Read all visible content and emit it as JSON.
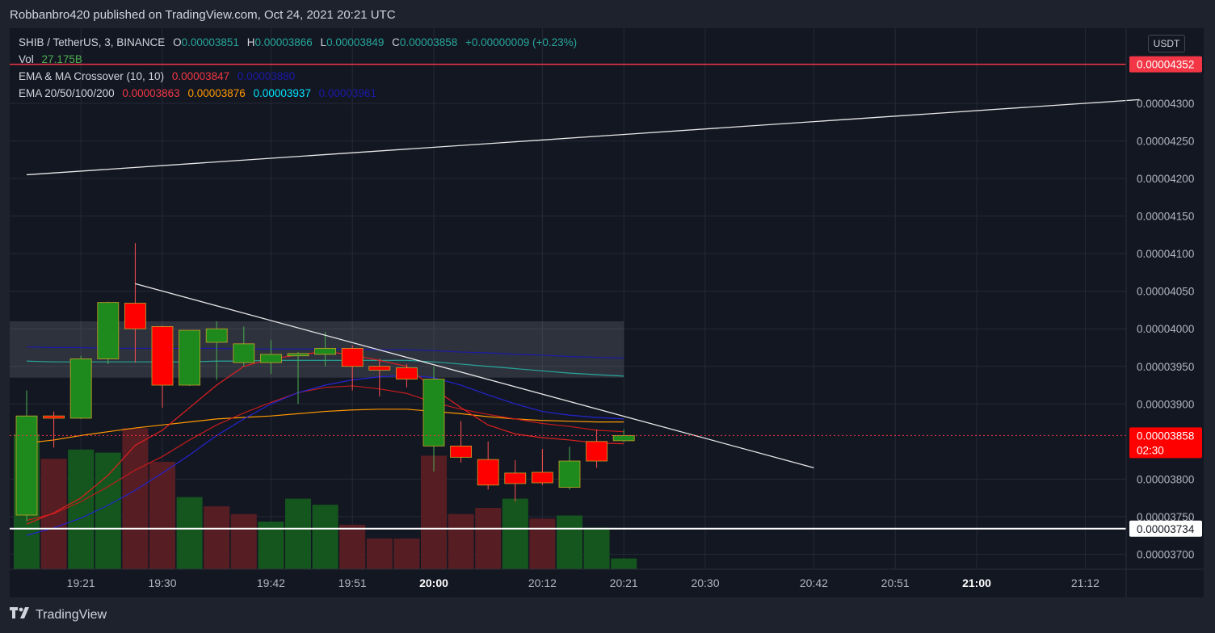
{
  "header": {
    "text": "Robbanbro420 published on TradingView.com, Oct 24, 2021 20:21 UTC"
  },
  "legend": {
    "symbol": "SHIB / TetherUS, 3, BINANCE",
    "o_label": "O",
    "o": "0.00003851",
    "h_label": "H",
    "h": "0.00003866",
    "l_label": "L",
    "l": "0.00003849",
    "c_label": "C",
    "c": "0.00003858",
    "change": "+0.00000009 (+0.23%)",
    "vol_label": "Vol",
    "vol": "27.175B",
    "crossover_label": "EMA & MA Crossover (10, 10)",
    "crossover_ema": "0.00003847",
    "crossover_ma": "0.00003880",
    "ema_label": "EMA 20/50/100/200",
    "ema20": "0.00003863",
    "ema50": "0.00003876",
    "ema100": "0.00003937",
    "ema200": "0.00003961"
  },
  "currency": "USDT",
  "footer": {
    "brand": "TradingView"
  },
  "colors": {
    "up": "#1e8a1e",
    "down": "#ff0000",
    "bg": "#131722",
    "grid": "#252a36",
    "ema20": "#c21c1c",
    "ema50": "#ff9800",
    "ema100": "#26a69a",
    "ema200": "#1a1aa6"
  },
  "chart_data": {
    "type": "candlestick",
    "x_ticks": [
      "19:21",
      "19:30",
      "19:42",
      "19:51",
      "20:00",
      "20:12",
      "20:21",
      "20:30",
      "20:42",
      "20:51",
      "21:00",
      "21:12"
    ],
    "y_ticks": [
      "0.00004300",
      "0.00004250",
      "0.00004200",
      "0.00004150",
      "0.00004100",
      "0.00004050",
      "0.00004000",
      "0.00003950",
      "0.00003900",
      "0.00003800",
      "0.00003750",
      "0.00003700"
    ],
    "y_range": [
      3.68e-05,
      4.4e-05
    ],
    "price_labels": {
      "alert_line": "0.00004352",
      "last_price": "0.00003858",
      "countdown": "02:30",
      "support_line": "0.00003734"
    },
    "candles": [
      {
        "o": 3.752e-05,
        "h": 3.918e-05,
        "l": 3.744e-05,
        "c": 3.884e-05
      },
      {
        "o": 3.884e-05,
        "h": 3.89e-05,
        "l": 3.842e-05,
        "c": 3.881e-05
      },
      {
        "o": 3.881e-05,
        "h": 3.964e-05,
        "l": 3.88e-05,
        "c": 3.96e-05
      },
      {
        "o": 3.96e-05,
        "h": 4.036e-05,
        "l": 3.953e-05,
        "c": 4.035e-05
      },
      {
        "o": 4.034e-05,
        "h": 4.114e-05,
        "l": 3.955e-05,
        "c": 4e-05
      },
      {
        "o": 4.003e-05,
        "h": 4.004e-05,
        "l": 3.895e-05,
        "c": 3.925e-05
      },
      {
        "o": 3.925e-05,
        "h": 3.998e-05,
        "l": 3.924e-05,
        "c": 3.998e-05
      },
      {
        "o": 3.982e-05,
        "h": 4.01e-05,
        "l": 3.932e-05,
        "c": 4e-05
      },
      {
        "o": 3.955e-05,
        "h": 4.003e-05,
        "l": 3.95e-05,
        "c": 3.98e-05
      },
      {
        "o": 3.955e-05,
        "h": 3.985e-05,
        "l": 3.94e-05,
        "c": 3.966e-05
      },
      {
        "o": 3.964e-05,
        "h": 3.969e-05,
        "l": 3.9e-05,
        "c": 3.967e-05
      },
      {
        "o": 3.966e-05,
        "h": 3.996e-05,
        "l": 3.95e-05,
        "c": 3.974e-05
      },
      {
        "o": 3.974e-05,
        "h": 3.978e-05,
        "l": 3.918e-05,
        "c": 3.95e-05
      },
      {
        "o": 3.95e-05,
        "h": 3.96e-05,
        "l": 3.91e-05,
        "c": 3.945e-05
      },
      {
        "o": 3.948e-05,
        "h": 3.953e-05,
        "l": 3.922e-05,
        "c": 3.933e-05
      },
      {
        "o": 3.844e-05,
        "h": 3.95e-05,
        "l": 3.81e-05,
        "c": 3.933e-05
      },
      {
        "o": 3.844e-05,
        "h": 3.877e-05,
        "l": 3.822e-05,
        "c": 3.829e-05
      },
      {
        "o": 3.826e-05,
        "h": 3.85e-05,
        "l": 3.786e-05,
        "c": 3.792e-05
      },
      {
        "o": 3.808e-05,
        "h": 3.825e-05,
        "l": 3.77e-05,
        "c": 3.794e-05
      },
      {
        "o": 3.809e-05,
        "h": 3.84e-05,
        "l": 3.792e-05,
        "c": 3.795e-05
      },
      {
        "o": 3.789e-05,
        "h": 3.843e-05,
        "l": 3.786e-05,
        "c": 3.824e-05
      },
      {
        "o": 3.85e-05,
        "h": 3.866e-05,
        "l": 3.815e-05,
        "c": 3.824e-05
      },
      {
        "o": 3.851e-05,
        "h": 3.866e-05,
        "l": 3.849e-05,
        "c": 3.858e-05
      }
    ],
    "volume": [
      0.88,
      0.72,
      0.78,
      0.76,
      0.92,
      0.7,
      0.47,
      0.41,
      0.36,
      0.31,
      0.46,
      0.42,
      0.29,
      0.2,
      0.2,
      0.74,
      0.36,
      0.4,
      0.46,
      0.33,
      0.35,
      0.27,
      0.07
    ],
    "volume_up": [
      true,
      false,
      true,
      true,
      false,
      false,
      true,
      false,
      false,
      true,
      true,
      true,
      false,
      false,
      false,
      false,
      false,
      false,
      true,
      false,
      true,
      true,
      true
    ],
    "ema20": [
      3.745e-05,
      3.754e-05,
      3.77e-05,
      3.79e-05,
      3.812e-05,
      3.83e-05,
      3.852e-05,
      3.872e-05,
      3.888e-05,
      3.902e-05,
      3.915e-05,
      3.922e-05,
      3.924e-05,
      3.92e-05,
      3.914e-05,
      3.902e-05,
      3.893e-05,
      3.886e-05,
      3.88e-05,
      3.874e-05,
      3.87e-05,
      3.865e-05,
      3.863e-05
    ],
    "ema50": [
      3.848e-05,
      3.852e-05,
      3.858e-05,
      3.863e-05,
      3.868e-05,
      3.872e-05,
      3.876e-05,
      3.88e-05,
      3.882e-05,
      3.884e-05,
      3.887e-05,
      3.89e-05,
      3.892e-05,
      3.893e-05,
      3.893e-05,
      3.89e-05,
      3.887e-05,
      3.883e-05,
      3.88e-05,
      3.878e-05,
      3.877e-05,
      3.876e-05,
      3.876e-05
    ],
    "ema100": [
      3.957e-05,
      3.956e-05,
      3.956e-05,
      3.956e-05,
      3.956e-05,
      3.956e-05,
      3.956e-05,
      3.957e-05,
      3.957e-05,
      3.958e-05,
      3.958e-05,
      3.958e-05,
      3.958e-05,
      3.958e-05,
      3.958e-05,
      3.956e-05,
      3.953e-05,
      3.95e-05,
      3.947e-05,
      3.944e-05,
      3.941e-05,
      3.939e-05,
      3.937e-05
    ],
    "ema200": [
      3.976e-05,
      3.975e-05,
      3.975e-05,
      3.974e-05,
      3.974e-05,
      3.974e-05,
      3.974e-05,
      3.974e-05,
      3.973e-05,
      3.973e-05,
      3.973e-05,
      3.973e-05,
      3.973e-05,
      3.972e-05,
      3.972e-05,
      3.971e-05,
      3.969e-05,
      3.968e-05,
      3.966e-05,
      3.965e-05,
      3.963e-05,
      3.962e-05,
      3.961e-05
    ],
    "ma_cross_ema": [
      3.74e-05,
      3.755e-05,
      3.775e-05,
      3.805e-05,
      3.845e-05,
      3.865e-05,
      3.895e-05,
      3.925e-05,
      3.95e-05,
      3.96e-05,
      3.965e-05,
      3.97e-05,
      3.965e-05,
      3.958e-05,
      3.95e-05,
      3.92e-05,
      3.895e-05,
      3.872e-05,
      3.86e-05,
      3.855e-05,
      3.852e-05,
      3.848e-05,
      3.847e-05
    ],
    "ma_cross_ma": [
      3.725e-05,
      3.735e-05,
      3.748e-05,
      3.765e-05,
      3.785e-05,
      3.808e-05,
      3.832e-05,
      3.858e-05,
      3.88e-05,
      3.9e-05,
      3.915e-05,
      3.925e-05,
      3.932e-05,
      3.936e-05,
      3.938e-05,
      3.935e-05,
      3.925e-05,
      3.912e-05,
      3.9e-05,
      3.89e-05,
      3.885e-05,
      3.882e-05,
      3.88e-05
    ],
    "resistance_zone": [
      3.935e-05,
      4.01e-05
    ],
    "trendline_up": {
      "from": {
        "x": "19:15",
        "y": 4.205e-05
      },
      "to": {
        "x": "21:18",
        "y": 4.305e-05
      }
    },
    "trendline_down": {
      "from": {
        "x": "19:27",
        "y": 4.06e-05
      },
      "to": {
        "x": "20:42",
        "y": 3.815e-05
      }
    }
  }
}
